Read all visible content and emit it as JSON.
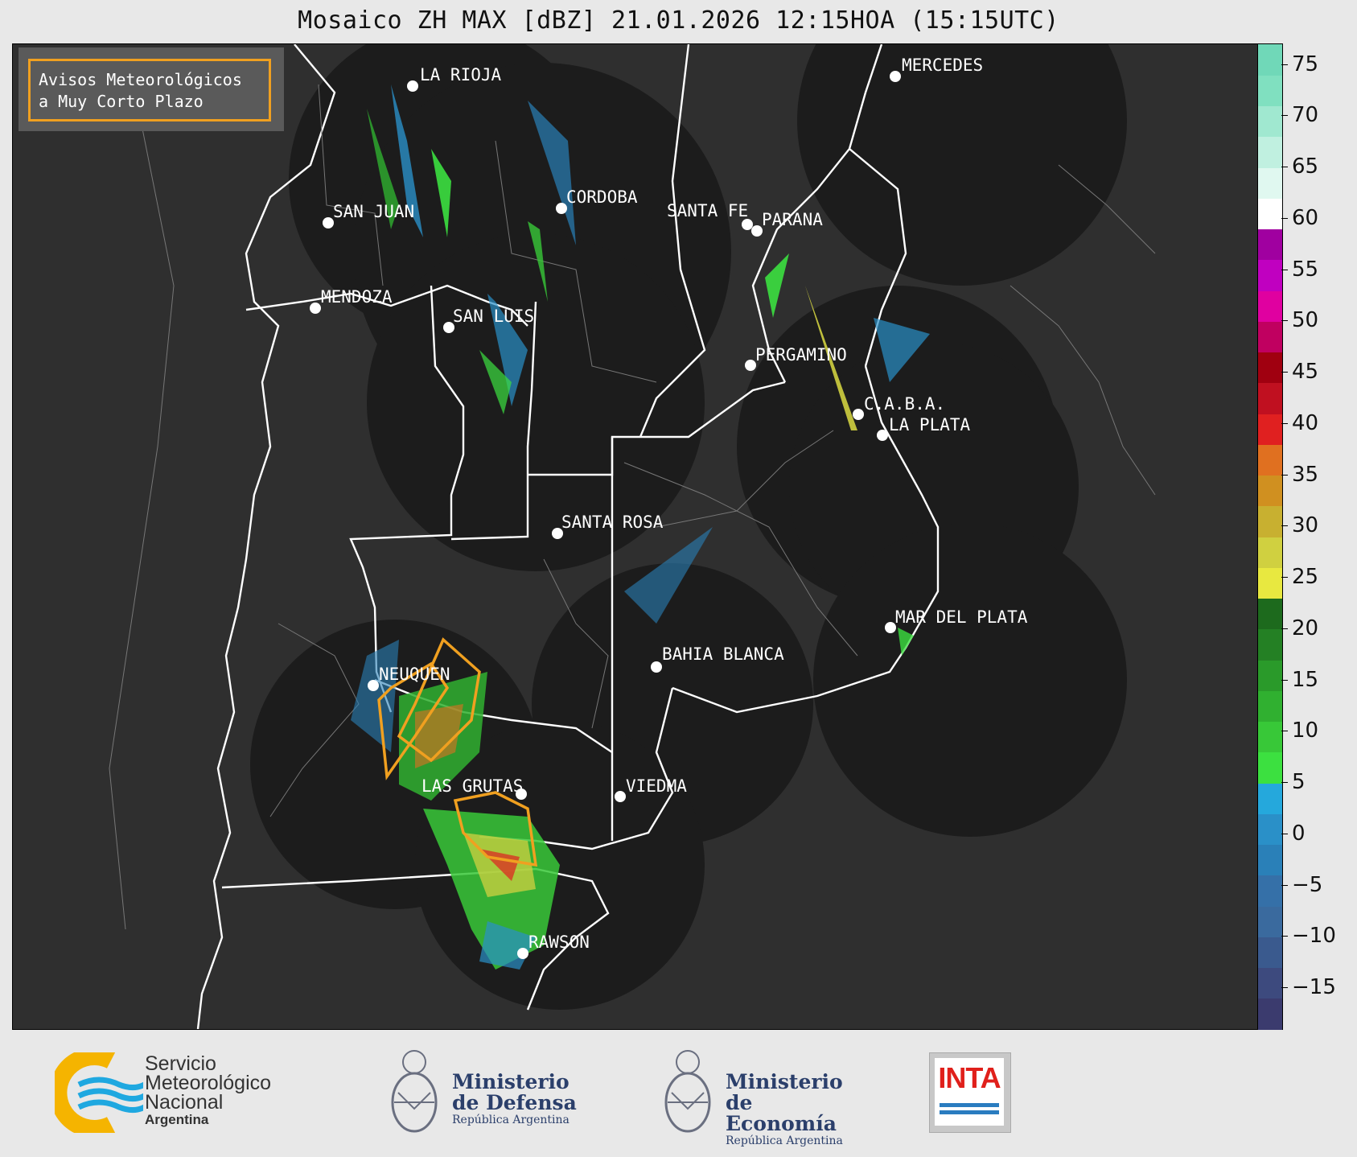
{
  "title": "Mosaico ZH MAX [dBZ] 21.01.2026 12:15HOA (15:15UTC)",
  "notice": {
    "line1": "Avisos Meteorológicos",
    "line2": "a Muy Corto Plazo",
    "border_color": "#f0a020"
  },
  "cities": [
    {
      "name": "LA RIOJA"
    },
    {
      "name": "MERCEDES"
    },
    {
      "name": "SAN JUAN"
    },
    {
      "name": "CORDOBA"
    },
    {
      "name": "SANTA FE"
    },
    {
      "name": "PARANA"
    },
    {
      "name": "MENDOZA"
    },
    {
      "name": "SAN LUIS"
    },
    {
      "name": "PERGAMINO"
    },
    {
      "name": "C.A.B.A."
    },
    {
      "name": "LA PLATA"
    },
    {
      "name": "SANTA ROSA"
    },
    {
      "name": "MAR DEL PLATA"
    },
    {
      "name": "BAHIA BLANCA"
    },
    {
      "name": "NEUQUEN"
    },
    {
      "name": "LAS GRUTAS"
    },
    {
      "name": "VIEDMA"
    },
    {
      "name": "RAWSON"
    }
  ],
  "colorbar": {
    "unit": "dBZ",
    "range": [
      -19,
      77
    ],
    "ticks": [
      "75",
      "70",
      "65",
      "60",
      "55",
      "50",
      "45",
      "40",
      "35",
      "30",
      "25",
      "20",
      "15",
      "10",
      "5",
      "0",
      "−5",
      "−10",
      "−15"
    ],
    "colors": [
      "#3b3b6e",
      "#3d4a7e",
      "#3a5a8e",
      "#3a6a9e",
      "#3570a8",
      "#2a80b8",
      "#2a90c8",
      "#25a8dc",
      "#3ce040",
      "#38c838",
      "#30b030",
      "#2a9a2a",
      "#248024",
      "#1d6a1d",
      "#e8e840",
      "#d0d040",
      "#c8b030",
      "#d09020",
      "#e07020",
      "#e02020",
      "#c01020",
      "#a00010",
      "#c00060",
      "#e000a0",
      "#c000c0",
      "#a000a0",
      "#ffffff",
      "#e0f8f0",
      "#c0f0e0",
      "#a0e8d0",
      "#80e0c0",
      "#70d8b8"
    ]
  },
  "footer": {
    "smn": {
      "line1": "Servicio",
      "line2": "Meteorológico",
      "line3": "Nacional",
      "line4": "Argentina",
      "color_blue": "#1fa8e0",
      "color_yellow": "#f5b400"
    },
    "defensa": {
      "line1": "Ministerio",
      "line2": "de Defensa",
      "sub": "República Argentina"
    },
    "economia": {
      "line1": "Ministerio",
      "line2": "de Economía",
      "sub": "República Argentina"
    },
    "inta": {
      "label": "INTA",
      "color": "#e0201b"
    }
  }
}
